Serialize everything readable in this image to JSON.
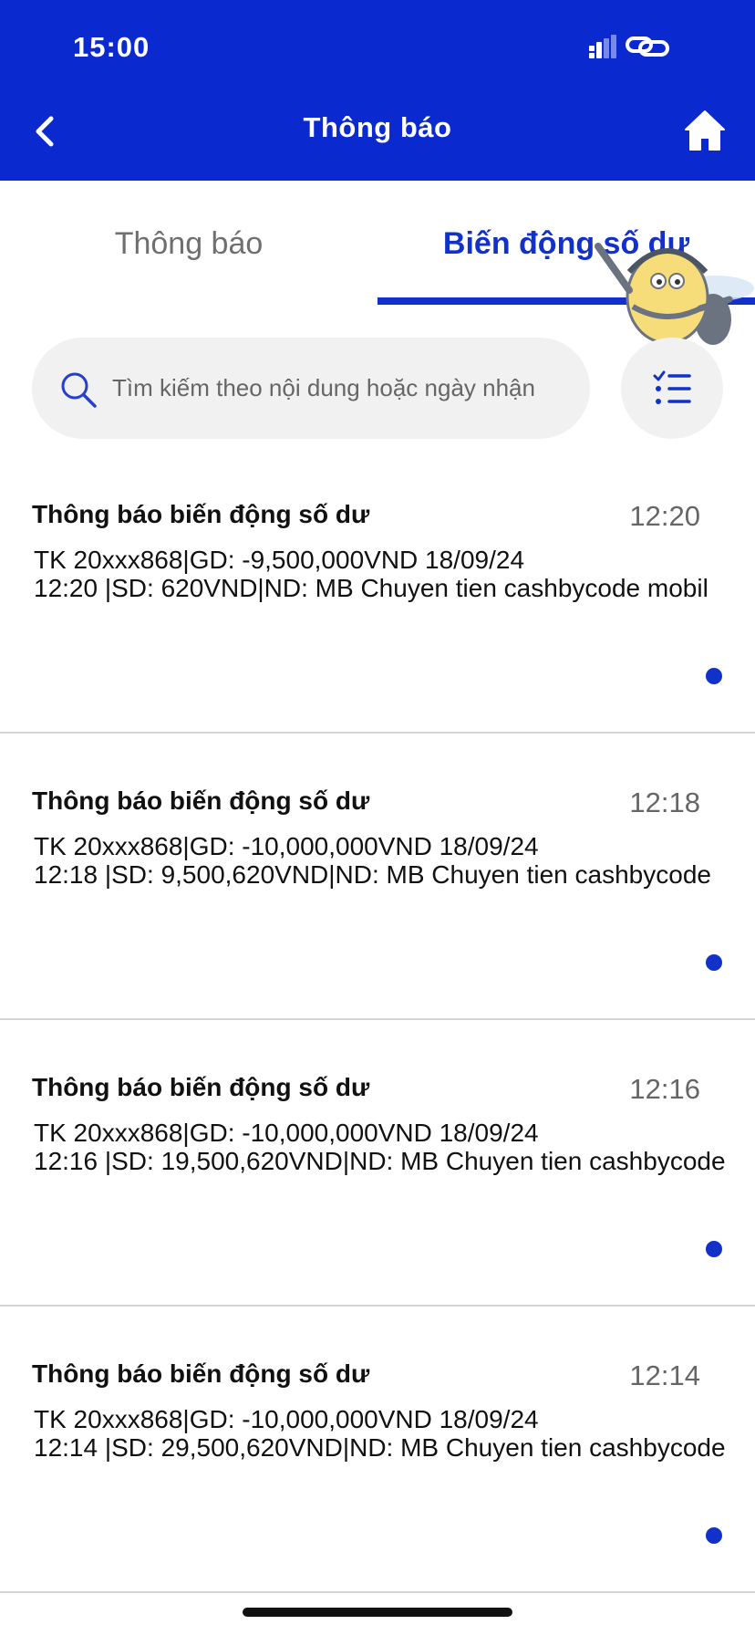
{
  "status_bar": {
    "time": "15:00"
  },
  "header": {
    "title": "Thông báo"
  },
  "tabs": [
    {
      "label": "Thông báo",
      "active": false
    },
    {
      "label": "Biến động số dư",
      "active": true
    }
  ],
  "search": {
    "placeholder": "Tìm kiếm theo nội dung hoặc ngày nhận",
    "value": ""
  },
  "notifications": [
    {
      "title": "Thông báo biến động số dư",
      "time": "12:20",
      "line1": "TK 20xxx868|GD: -9,500,000VND 18/09/24",
      "line2": "12:20 |SD: 620VND|ND: MB Chuyen tien cashbycode mobil",
      "unread": true
    },
    {
      "title": "Thông báo biến động số dư",
      "time": "12:18",
      "line1": "TK 20xxx868|GD: -10,000,000VND 18/09/24",
      "line2": "12:18 |SD: 9,500,620VND|ND: MB Chuyen tien cashbycode",
      "unread": true
    },
    {
      "title": "Thông báo biến động số dư",
      "time": "12:16",
      "line1": "TK 20xxx868|GD: -10,000,000VND 18/09/24",
      "line2": "12:16 |SD: 19,500,620VND|ND: MB Chuyen tien cashbycode",
      "unread": true
    },
    {
      "title": "Thông báo biến động số dư",
      "time": "12:14",
      "line1": "TK 20xxx868|GD: -10,000,000VND 18/09/24",
      "line2": "12:14 |SD: 29,500,620VND|ND: MB Chuyen tien cashbycode",
      "unread": true
    }
  ],
  "colors": {
    "primary": "#0a2ad0",
    "accent": "#1231c8",
    "search_bg": "#f1f1f1"
  },
  "icons": [
    "chevron-left-icon",
    "home-icon",
    "search-icon",
    "checklist-icon",
    "signal-icon",
    "link-icon"
  ]
}
